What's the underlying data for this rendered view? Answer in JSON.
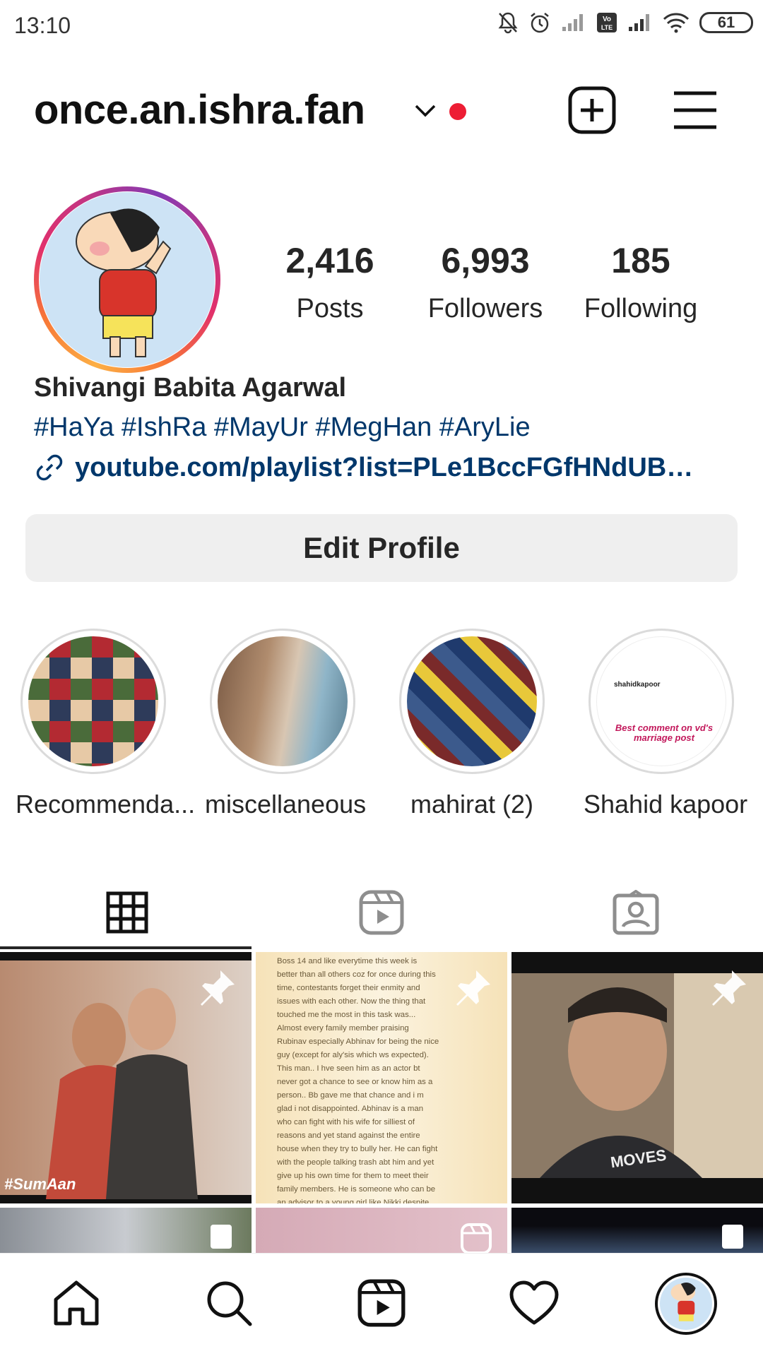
{
  "status_bar": {
    "time": "13:10",
    "battery": "61",
    "icons": [
      "mute-icon",
      "alarm-icon",
      "signal-icon",
      "volte-icon",
      "signal-icon",
      "wifi-icon",
      "battery-icon"
    ]
  },
  "header": {
    "username": "once.an.ishra.fan",
    "icons": [
      "chevron-down-icon",
      "notification-dot",
      "new-post-icon",
      "menu-icon"
    ],
    "accent_dot_color": "#ed1d34"
  },
  "profile": {
    "stats": [
      {
        "value": "2,416",
        "label": "Posts"
      },
      {
        "value": "6,993",
        "label": "Followers"
      },
      {
        "value": "185",
        "label": "Following"
      }
    ],
    "full_name": "Shivangi Babita Agarwal",
    "bio": "#HaYa #IshRa #MayUr #MegHan #AryLie",
    "link": "youtube.com/playlist?list=PLe1BccFGfHNdUB…",
    "edit_button": "Edit Profile"
  },
  "highlights": [
    {
      "label": "Recommenda..."
    },
    {
      "label": "miscellaneous"
    },
    {
      "label": "mahirat (2)"
    },
    {
      "label": "Shahid kapoor"
    }
  ],
  "highlight_inner_texts": {
    "shahid_caption": "Best comment on vd's marriage post",
    "shahid_comment_user": "shahidkapoor"
  },
  "tabs": [
    {
      "name": "grid-icon",
      "active": true
    },
    {
      "name": "reels-icon",
      "active": false
    },
    {
      "name": "tagged-icon",
      "active": false
    }
  ],
  "posts": [
    {
      "caption": "#SumAan",
      "pinned": true
    },
    {
      "text_lines": [
        "Boss 14 and like everytime this week is",
        "better than all others coz for once during this",
        "time, contestants forget their enmity and",
        "issues with each other. Now the thing that",
        "touched me the most in this task was...",
        "Almost every family member praising",
        "Rubinav especially Abhinav for being the nice",
        "guy (except for aly'sis which ws expected).",
        "This man.. I hve seen him as an actor bt",
        "never got a chance to see or know him as a",
        "person.. Bb gave me that chance and i m",
        "glad i not disappointed. Abhinav is a man",
        "who can fight with his wife for silliest of",
        "reasons and yet stand against the entire",
        "house when they try to bully her. He can fight",
        "with the people talking trash abt him and yet",
        "give up his own time for them to meet their",
        "family members. He is someone who can be",
        "an advisor to a young girl like Nikki despite"
      ],
      "pinned": true
    },
    {
      "shirt_text": "MOVES",
      "pinned": true
    }
  ],
  "bottom_nav": [
    "home-icon",
    "search-icon",
    "reels-icon",
    "activity-icon",
    "profile-avatar"
  ]
}
